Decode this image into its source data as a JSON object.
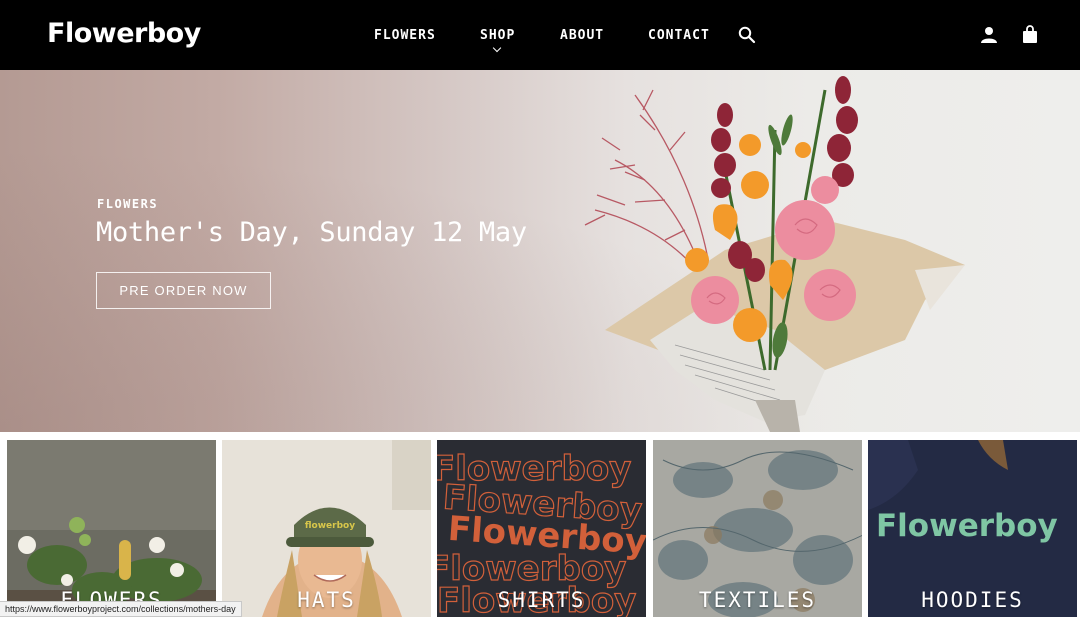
{
  "header": {
    "logo": "Flowerboy",
    "nav": [
      "FLOWERS",
      "SHOP",
      "ABOUT",
      "CONTACT"
    ],
    "icons": [
      "search-icon",
      "account-icon",
      "cart-icon"
    ]
  },
  "hero": {
    "eyebrow": "FLOWERS",
    "title": "Mother's Day, Sunday 12 May",
    "button": "PRE ORDER NOW"
  },
  "categories": [
    {
      "label": "FLOWERS"
    },
    {
      "label": "HATS",
      "hat_text": "flowerboy"
    },
    {
      "label": "SHIRTS",
      "print_text": "Flowerboy"
    },
    {
      "label": "TEXTILES"
    },
    {
      "label": "HOODIES",
      "print_text": "Flowerboy"
    }
  ],
  "status_bar": "https://www.flowerboyproject.com/collections/mothers-day",
  "colors": {
    "header_bg": "#000000",
    "text_on_dark": "#ffffff",
    "shirt_print": "#d2603a",
    "hoodie_print": "#7fc6a4"
  }
}
